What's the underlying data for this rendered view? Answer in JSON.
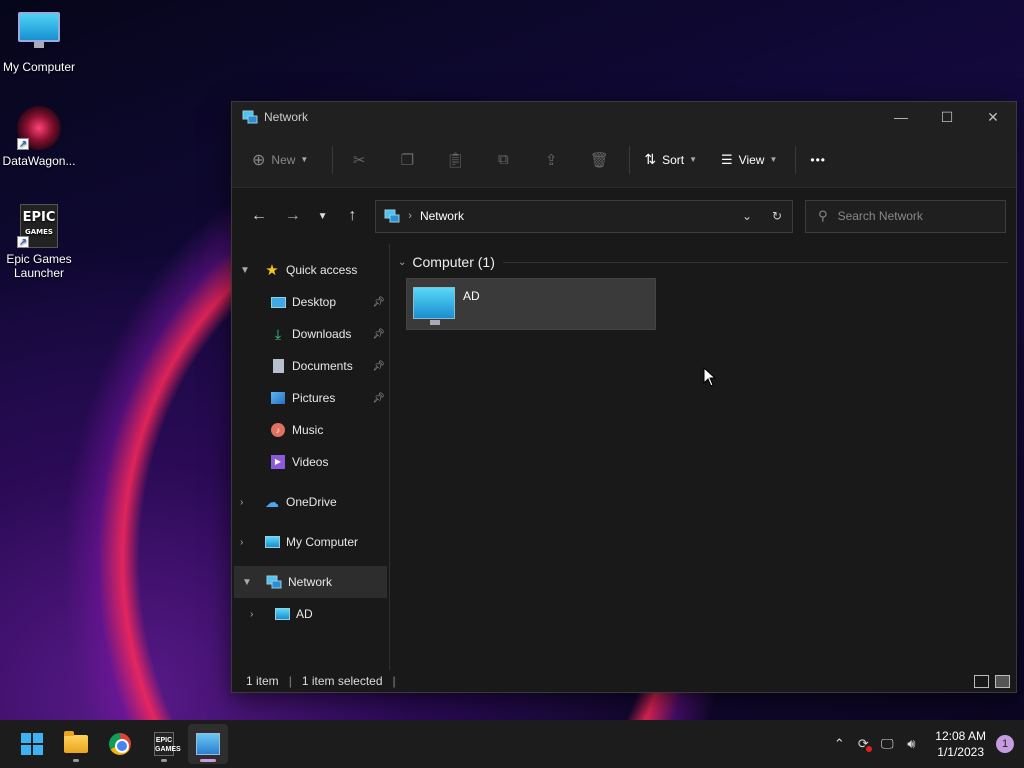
{
  "desktop": {
    "icons": [
      {
        "label": "My Computer"
      },
      {
        "label": "DataWagon..."
      },
      {
        "label": "Epic Games Launcher"
      }
    ]
  },
  "window": {
    "title": "Network",
    "controls": {
      "minimize": "—",
      "maximize": "☐",
      "close": "✕"
    }
  },
  "toolbar": {
    "new_label": "New",
    "sort_label": "Sort",
    "view_label": "View",
    "more_label": "•••"
  },
  "address": {
    "crumb": "Network"
  },
  "search": {
    "placeholder": "Search Network"
  },
  "sidebar": {
    "quick_access": "Quick access",
    "pinned": [
      {
        "label": "Desktop",
        "pinned": true
      },
      {
        "label": "Downloads",
        "pinned": true
      },
      {
        "label": "Documents",
        "pinned": true
      },
      {
        "label": "Pictures",
        "pinned": true
      },
      {
        "label": "Music",
        "pinned": false
      },
      {
        "label": "Videos",
        "pinned": false
      }
    ],
    "onedrive": "OneDrive",
    "my_computer": "My Computer",
    "network": "Network",
    "network_child": "AD"
  },
  "content": {
    "group_title": "Computer (1)",
    "items": [
      {
        "name": "AD"
      }
    ]
  },
  "status": {
    "count": "1 item",
    "selected": "1 item selected"
  },
  "taskbar": {
    "time": "12:08 AM",
    "date": "1/1/2023",
    "notifications": "1"
  },
  "colors": {
    "accent": "#c79be0",
    "window_bg": "#191919",
    "selected_tile": "#3a3a3a"
  }
}
